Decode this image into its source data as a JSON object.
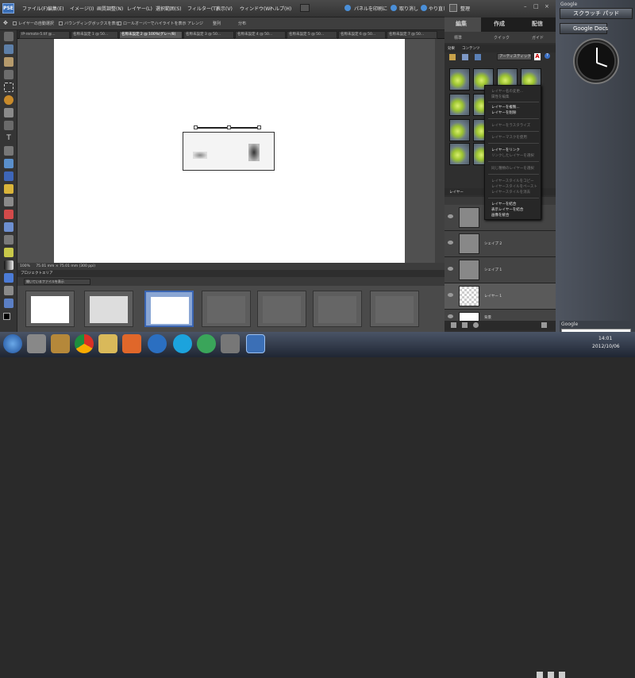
{
  "app": {
    "logo": "PSE",
    "menus": [
      "ファイル(F)",
      "編集(E)",
      "イメージ(I)",
      "画質調整(N)",
      "レイヤー(L)",
      "選択範囲(S)",
      "フィルター(T)",
      "表示(V)",
      "ウィンドウ(W)",
      "ヘルプ(H)"
    ],
    "actions": {
      "print_panel": "パネルを印刷に",
      "undo": "取り消し",
      "redo": "やり直し",
      "organize": "整理"
    }
  },
  "options": {
    "auto_select": "レイヤーの自動選択",
    "show_bbox": "バウンディングボックスを表示",
    "rollover": "ロールオーバーでハイライトを表示",
    "arrange": "アレンジ",
    "align": "整列",
    "distribute": "分布"
  },
  "tabs": [
    "IP-remote-5.tif @...",
    "名称未設定 1 @ 50...",
    "名称未設定 2 @ 100%(グレー/8)",
    "名称未設定 3 @ 50...",
    "名称未設定 4 @ 50...",
    "名称未設定 5 @ 50...",
    "名称未設定 6 @ 50...",
    "名称未設定 7 @ 50..."
  ],
  "status": {
    "zoom": "100%",
    "size": "75.01 mm × 75.01 mm (300 ppi)"
  },
  "project_bin": {
    "title": "プロジェクトエリア",
    "filter": "開いているファイルを表示"
  },
  "right_panel": {
    "modes": [
      "編集",
      "作成",
      "配信"
    ],
    "submodes": [
      "標準",
      "クイック",
      "ガイド"
    ],
    "effects_tabs": [
      "効果",
      "コンテンツ"
    ],
    "effects_filter": "アーティスティック",
    "layers_title": "レイヤー"
  },
  "context_menu": [
    {
      "label": "レイヤー名の変更...",
      "enabled": false
    },
    {
      "label": "属性を編集",
      "enabled": false
    },
    {
      "label": "レイヤーを複製...",
      "enabled": true
    },
    {
      "label": "レイヤーを削除",
      "enabled": true
    },
    {
      "label": "レイヤーをラスタライズ",
      "enabled": false
    },
    {
      "label": "レイヤーマスクを使用",
      "enabled": false
    },
    {
      "label": "レイヤーをリンク",
      "enabled": true
    },
    {
      "label": "リンクしたレイヤーを選択",
      "enabled": false
    },
    {
      "label": "同じ種類のレイヤーを選択",
      "enabled": false
    },
    {
      "label": "レイヤースタイルをコピー",
      "enabled": false
    },
    {
      "label": "レイヤースタイルをペースト",
      "enabled": false
    },
    {
      "label": "レイヤースタイルを消去",
      "enabled": false
    },
    {
      "label": "レイヤーを結合",
      "enabled": true
    },
    {
      "label": "表示レイヤーを結合",
      "enabled": true
    },
    {
      "label": "画像を統合",
      "enabled": true
    }
  ],
  "layers": [
    "",
    "シェイプ 2",
    "シェイプ 1",
    "レイヤー 1",
    "背景"
  ],
  "gadgets": {
    "scratch": "スクラッチ パッド",
    "docs": "Google Docs",
    "brand": "Google"
  },
  "tray": {
    "time": "14:01",
    "date": "2012/10/06"
  }
}
